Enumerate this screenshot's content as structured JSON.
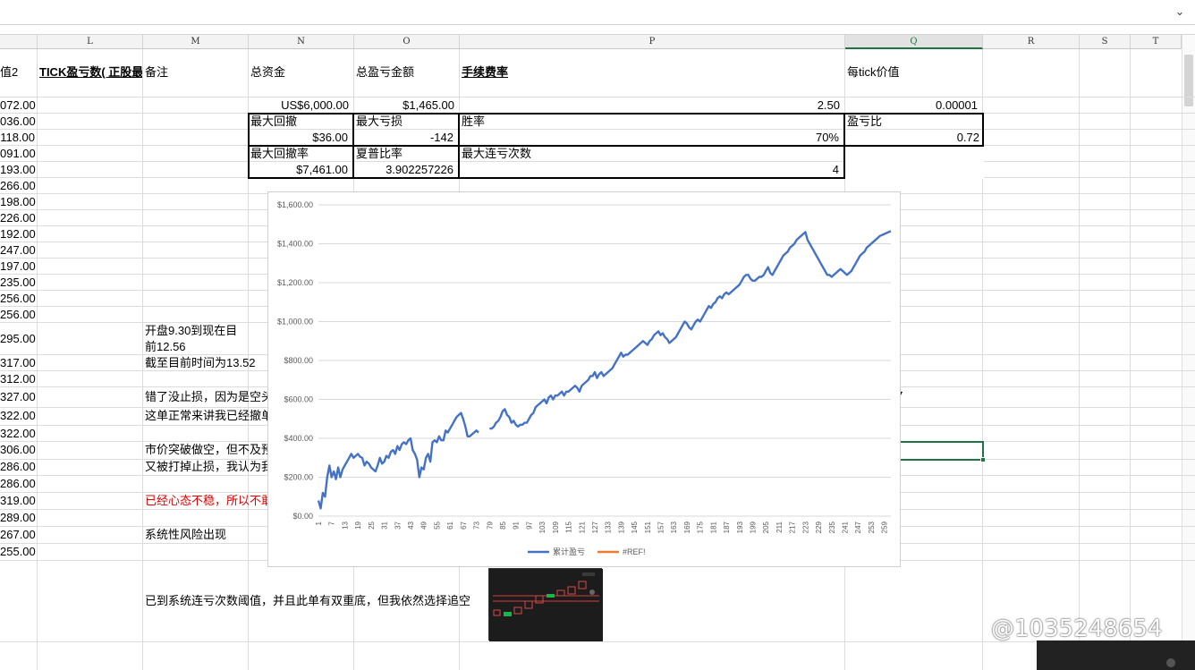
{
  "columns": [
    "L",
    "M",
    "N",
    "O",
    "P",
    "Q",
    "R",
    "S",
    "T"
  ],
  "selected_column": "Q",
  "headers": {
    "k_partial": "值2",
    "l": "TICK盈亏数( 正股最",
    "m": "备注",
    "n": "总资金",
    "o": "总盈亏金额",
    "p": "手续费率",
    "q": "每tick价值"
  },
  "k_values": [
    "072.00",
    "036.00",
    "118.00",
    "091.00",
    "193.00",
    "266.00",
    "198.00",
    "226.00",
    "192.00",
    "247.00",
    "197.00",
    "235.00",
    "256.00",
    "256.00",
    "295.00",
    "317.00",
    "312.00",
    "327.00",
    "322.00",
    "322.00",
    "306.00",
    "286.00",
    "286.00",
    "319.00",
    "289.00",
    "267.00",
    "255.00"
  ],
  "summary": {
    "total_capital": "US$6,000.00",
    "total_pnl": "$1,465.00",
    "fee_rate": "2.50",
    "tick_value": "0.00001",
    "max_drawdown_label": "最大回撤",
    "max_drawdown_value": "$36.00",
    "max_loss_label": "最大亏损",
    "max_loss_value": "-142",
    "win_rate_label": "胜率",
    "win_rate_value": "70%",
    "pl_ratio_label": "盈亏比",
    "pl_ratio_value": "0.72",
    "max_dd_rate_label": "最大回撤率",
    "max_dd_rate_value": "$7,461.00",
    "sharpe_label": "夏普比率",
    "sharpe_value": "3.902257226",
    "max_consec_loss_label": "最大连亏次数",
    "max_consec_loss_value": "4"
  },
  "notes": {
    "n1_line1": "开盘9.30到现在目",
    "n1_line2": "前12.56",
    "n2": "截至目前时间为13.52",
    "n3": "错了没止损，因为是空头",
    "n4": "这单正常来讲我已经撤单",
    "n5": "市价突破做空，但不及预",
    "n6": "又被打掉止损，我认为我",
    "n7": "已经心态不稳，所以不敢",
    "n8": "系统性风险出现",
    "n9": "已到系统连亏次数阈值，并且此单有双重底，但我依然选择追空"
  },
  "chart_data": {
    "type": "line",
    "title": "",
    "xlabel": "",
    "ylabel": "",
    "ylim": [
      0,
      1600
    ],
    "y_ticks": [
      "$0.00",
      "$200.00",
      "$400.00",
      "$600.00",
      "$800.00",
      "$1,000.00",
      "$1,200.00",
      "$1,400.00",
      "$1,600.00"
    ],
    "x_ticks": [
      "1",
      "7",
      "13",
      "19",
      "25",
      "31",
      "37",
      "43",
      "49",
      "55",
      "61",
      "67",
      "73",
      "79",
      "85",
      "91",
      "97",
      "103",
      "109",
      "115",
      "121",
      "127",
      "133",
      "139",
      "145",
      "151",
      "157",
      "163",
      "169",
      "175",
      "181",
      "187",
      "193",
      "199",
      "205",
      "211",
      "217",
      "223",
      "229",
      "235",
      "241",
      "247",
      "253",
      "259"
    ],
    "x_range": [
      1,
      262
    ],
    "gap_between": [
      74,
      79
    ],
    "series": [
      {
        "name": "累计盈亏",
        "color": "#4472c4",
        "points": [
          [
            1,
            80
          ],
          [
            2,
            40
          ],
          [
            3,
            120
          ],
          [
            4,
            100
          ],
          [
            5,
            200
          ],
          [
            6,
            260
          ],
          [
            7,
            200
          ],
          [
            8,
            230
          ],
          [
            9,
            190
          ],
          [
            10,
            250
          ],
          [
            11,
            200
          ],
          [
            12,
            240
          ],
          [
            13,
            260
          ],
          [
            14,
            280
          ],
          [
            15,
            300
          ],
          [
            16,
            320
          ],
          [
            17,
            300
          ],
          [
            18,
            310
          ],
          [
            19,
            320
          ],
          [
            20,
            305
          ],
          [
            21,
            300
          ],
          [
            22,
            260
          ],
          [
            23,
            280
          ],
          [
            24,
            270
          ],
          [
            25,
            250
          ],
          [
            26,
            240
          ],
          [
            27,
            230
          ],
          [
            28,
            260
          ],
          [
            29,
            300
          ],
          [
            30,
            270
          ],
          [
            31,
            280
          ],
          [
            32,
            310
          ],
          [
            33,
            300
          ],
          [
            34,
            330
          ],
          [
            35,
            340
          ],
          [
            36,
            320
          ],
          [
            37,
            360
          ],
          [
            38,
            340
          ],
          [
            39,
            370
          ],
          [
            40,
            380
          ],
          [
            41,
            370
          ],
          [
            42,
            390
          ],
          [
            43,
            400
          ],
          [
            44,
            340
          ],
          [
            45,
            320
          ],
          [
            46,
            290
          ],
          [
            47,
            200
          ],
          [
            48,
            250
          ],
          [
            49,
            240
          ],
          [
            50,
            300
          ],
          [
            51,
            320
          ],
          [
            52,
            280
          ],
          [
            53,
            380
          ],
          [
            54,
            390
          ],
          [
            55,
            380
          ],
          [
            56,
            410
          ],
          [
            57,
            390
          ],
          [
            58,
            390
          ],
          [
            59,
            440
          ],
          [
            60,
            430
          ],
          [
            61,
            450
          ],
          [
            62,
            470
          ],
          [
            63,
            490
          ],
          [
            64,
            510
          ],
          [
            65,
            520
          ],
          [
            66,
            530
          ],
          [
            67,
            500
          ],
          [
            68,
            460
          ],
          [
            69,
            410
          ],
          [
            70,
            410
          ],
          [
            71,
            420
          ],
          [
            72,
            430
          ],
          [
            73,
            440
          ],
          [
            74,
            430
          ],
          [
            79,
            450
          ],
          [
            80,
            450
          ],
          [
            81,
            460
          ],
          [
            82,
            480
          ],
          [
            83,
            490
          ],
          [
            84,
            510
          ],
          [
            85,
            540
          ],
          [
            86,
            550
          ],
          [
            87,
            520
          ],
          [
            88,
            510
          ],
          [
            89,
            480
          ],
          [
            90,
            490
          ],
          [
            91,
            470
          ],
          [
            92,
            460
          ],
          [
            93,
            470
          ],
          [
            94,
            470
          ],
          [
            95,
            480
          ],
          [
            96,
            480
          ],
          [
            97,
            500
          ],
          [
            98,
            520
          ],
          [
            99,
            530
          ],
          [
            100,
            560
          ],
          [
            101,
            570
          ],
          [
            102,
            580
          ],
          [
            103,
            590
          ],
          [
            104,
            600
          ],
          [
            105,
            580
          ],
          [
            106,
            610
          ],
          [
            107,
            620
          ],
          [
            108,
            600
          ],
          [
            109,
            620
          ],
          [
            110,
            620
          ],
          [
            111,
            630
          ],
          [
            112,
            640
          ],
          [
            113,
            620
          ],
          [
            114,
            640
          ],
          [
            115,
            640
          ],
          [
            116,
            650
          ],
          [
            117,
            660
          ],
          [
            118,
            670
          ],
          [
            119,
            660
          ],
          [
            120,
            640
          ],
          [
            121,
            670
          ],
          [
            122,
            680
          ],
          [
            123,
            690
          ],
          [
            124,
            700
          ],
          [
            125,
            720
          ],
          [
            126,
            720
          ],
          [
            127,
            740
          ],
          [
            128,
            710
          ],
          [
            129,
            730
          ],
          [
            130,
            740
          ],
          [
            131,
            720
          ],
          [
            132,
            730
          ],
          [
            133,
            740
          ],
          [
            134,
            750
          ],
          [
            135,
            760
          ],
          [
            136,
            780
          ],
          [
            137,
            800
          ],
          [
            138,
            820
          ],
          [
            139,
            840
          ],
          [
            140,
            820
          ],
          [
            141,
            830
          ],
          [
            142,
            830
          ],
          [
            143,
            840
          ],
          [
            144,
            850
          ],
          [
            145,
            860
          ],
          [
            146,
            870
          ],
          [
            147,
            880
          ],
          [
            148,
            890
          ],
          [
            149,
            900
          ],
          [
            150,
            890
          ],
          [
            151,
            880
          ],
          [
            152,
            900
          ],
          [
            153,
            910
          ],
          [
            154,
            930
          ],
          [
            155,
            940
          ],
          [
            156,
            950
          ],
          [
            157,
            930
          ],
          [
            158,
            940
          ],
          [
            159,
            920
          ],
          [
            160,
            910
          ],
          [
            161,
            890
          ],
          [
            162,
            900
          ],
          [
            163,
            910
          ],
          [
            164,
            920
          ],
          [
            165,
            940
          ],
          [
            166,
            960
          ],
          [
            167,
            980
          ],
          [
            168,
            1000
          ],
          [
            169,
            990
          ],
          [
            170,
            970
          ],
          [
            171,
            960
          ],
          [
            172,
            980
          ],
          [
            173,
            1000
          ],
          [
            174,
            1010
          ],
          [
            175,
            1000
          ],
          [
            176,
            1020
          ],
          [
            177,
            1040
          ],
          [
            178,
            1060
          ],
          [
            179,
            1080
          ],
          [
            180,
            1070
          ],
          [
            181,
            1090
          ],
          [
            182,
            1100
          ],
          [
            183,
            1120
          ],
          [
            184,
            1130
          ],
          [
            185,
            1120
          ],
          [
            186,
            1140
          ],
          [
            187,
            1150
          ],
          [
            188,
            1140
          ],
          [
            189,
            1150
          ],
          [
            190,
            1160
          ],
          [
            191,
            1170
          ],
          [
            192,
            1180
          ],
          [
            193,
            1190
          ],
          [
            194,
            1210
          ],
          [
            195,
            1230
          ],
          [
            196,
            1240
          ],
          [
            197,
            1240
          ],
          [
            198,
            1220
          ],
          [
            199,
            1210
          ],
          [
            200,
            1210
          ],
          [
            201,
            1220
          ],
          [
            202,
            1230
          ],
          [
            203,
            1230
          ],
          [
            204,
            1240
          ],
          [
            205,
            1260
          ],
          [
            206,
            1280
          ],
          [
            207,
            1250
          ],
          [
            208,
            1240
          ],
          [
            209,
            1260
          ],
          [
            210,
            1280
          ],
          [
            211,
            1300
          ],
          [
            212,
            1320
          ],
          [
            213,
            1340
          ],
          [
            214,
            1350
          ],
          [
            215,
            1360
          ],
          [
            216,
            1380
          ],
          [
            217,
            1390
          ],
          [
            218,
            1400
          ],
          [
            219,
            1420
          ],
          [
            220,
            1430
          ],
          [
            221,
            1440
          ],
          [
            222,
            1450
          ],
          [
            223,
            1460
          ],
          [
            224,
            1420
          ],
          [
            225,
            1400
          ],
          [
            226,
            1380
          ],
          [
            227,
            1360
          ],
          [
            228,
            1340
          ],
          [
            229,
            1320
          ],
          [
            230,
            1300
          ],
          [
            231,
            1280
          ],
          [
            232,
            1260
          ],
          [
            233,
            1240
          ],
          [
            234,
            1240
          ],
          [
            235,
            1230
          ],
          [
            236,
            1240
          ],
          [
            237,
            1250
          ],
          [
            238,
            1260
          ],
          [
            239,
            1270
          ],
          [
            240,
            1260
          ],
          [
            241,
            1250
          ],
          [
            242,
            1240
          ],
          [
            243,
            1250
          ],
          [
            244,
            1260
          ],
          [
            245,
            1280
          ],
          [
            246,
            1300
          ],
          [
            247,
            1320
          ],
          [
            248,
            1340
          ],
          [
            249,
            1350
          ],
          [
            250,
            1360
          ],
          [
            251,
            1380
          ],
          [
            252,
            1390
          ],
          [
            253,
            1400
          ],
          [
            254,
            1410
          ],
          [
            255,
            1420
          ],
          [
            256,
            1430
          ],
          [
            257,
            1440
          ],
          [
            258,
            1445
          ],
          [
            259,
            1450
          ],
          [
            260,
            1455
          ],
          [
            261,
            1460
          ],
          [
            262,
            1465
          ]
        ]
      },
      {
        "name": "#REF!",
        "color": "#ed7d31",
        "points": []
      }
    ],
    "legend_position": "bottom"
  },
  "watermark": "@1035248654"
}
